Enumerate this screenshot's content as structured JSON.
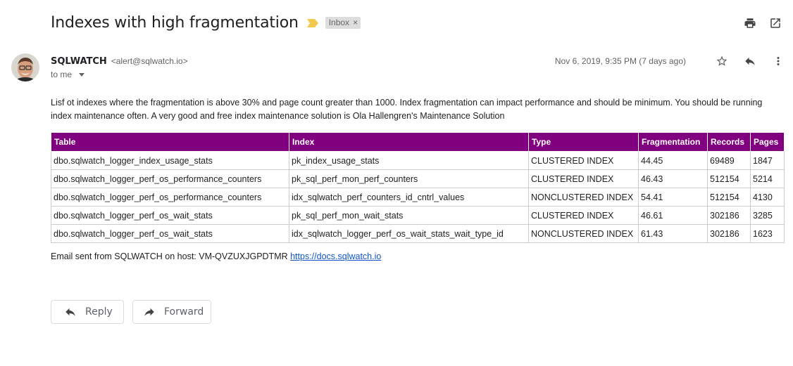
{
  "email": {
    "subject": "Indexes with high fragmentation",
    "label": "Inbox",
    "sender_name": "SQLWATCH",
    "sender_email": "<alert@sqlwatch.io>",
    "recipient": "to me",
    "date": "Nov 6, 2019, 9:35 PM (7 days ago)",
    "body": "Lisf ot indexes where the fragmentation is above 30% and page count greater than 1000. Index fragmentation can impact performance and should be minimum. You should be running index maintenance often. A very good and free index maintenance solution is Ola Hallengren's Maintenance Solution",
    "footer_text": "Email sent from SQLWATCH on host: VM-QVZUXJGPDTMR ",
    "footer_link": "https://docs.sqlwatch.io"
  },
  "table": {
    "headers": [
      "Table",
      "Index",
      "Type",
      "Fragmentation",
      "Records",
      "Pages"
    ],
    "rows": [
      [
        "dbo.sqlwatch_logger_index_usage_stats",
        "pk_index_usage_stats",
        "CLUSTERED INDEX",
        "44.45",
        "69489",
        "1847"
      ],
      [
        "dbo.sqlwatch_logger_perf_os_performance_counters",
        "pk_sql_perf_mon_perf_counters",
        "CLUSTERED INDEX",
        "46.43",
        "512154",
        "5214"
      ],
      [
        "dbo.sqlwatch_logger_perf_os_performance_counters",
        "idx_sqlwatch_perf_counters_id_cntrl_values",
        "NONCLUSTERED INDEX",
        "54.41",
        "512154",
        "4130"
      ],
      [
        "dbo.sqlwatch_logger_perf_os_wait_stats",
        "pk_sql_perf_mon_wait_stats",
        "CLUSTERED INDEX",
        "46.61",
        "302186",
        "3285"
      ],
      [
        "dbo.sqlwatch_logger_perf_os_wait_stats",
        "idx_sqlwatch_logger_perf_os_wait_stats_wait_type_id",
        "NONCLUSTERED INDEX",
        "61.43",
        "302186",
        "1623"
      ]
    ]
  },
  "actions": {
    "reply_label": "Reply",
    "forward_label": "Forward"
  },
  "icons": {
    "importance": "importance-marker-icon",
    "print": "print-icon",
    "open_new_window": "open-in-new-window-icon",
    "star": "star-icon",
    "reply": "reply-icon",
    "more": "more-vert-icon",
    "forward": "forward-icon"
  },
  "colors": {
    "table_header_bg": "#800080",
    "importance": "#f2c94c",
    "link": "#1155cc"
  }
}
